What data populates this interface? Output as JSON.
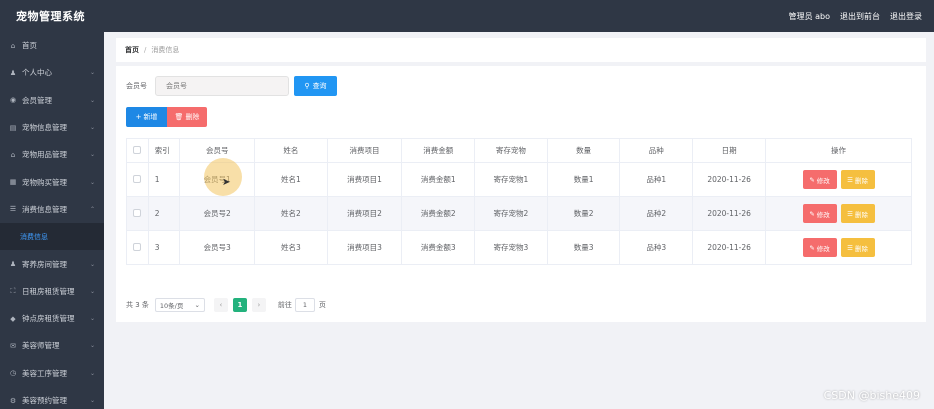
{
  "app": {
    "title": "宠物管理系统"
  },
  "topbar": {
    "user": "管理员 abo",
    "back_to_front": "退出到前台",
    "logout": "退出登录"
  },
  "sidebar": {
    "items": [
      {
        "label": "首页",
        "icon": "home-icon",
        "chevron": false
      },
      {
        "label": "个人中心",
        "icon": "user-icon",
        "chevron": true
      },
      {
        "label": "会员管理",
        "icon": "microphone-icon",
        "chevron": true
      },
      {
        "label": "宠物信息管理",
        "icon": "doc-icon",
        "chevron": true
      },
      {
        "label": "宠物用品管理",
        "icon": "bank-icon",
        "chevron": true
      },
      {
        "label": "宠物购买管理",
        "icon": "grid-icon",
        "chevron": true
      },
      {
        "label": "消费信息管理",
        "icon": "list-icon",
        "chevron": true,
        "expanded": true
      },
      {
        "label": "消费信息",
        "submenu": true
      },
      {
        "label": "寄养房间管理",
        "icon": "user-icon",
        "chevron": true
      },
      {
        "label": "日租房租赁管理",
        "icon": "fullscreen-icon",
        "chevron": true
      },
      {
        "label": "钟点房租赁管理",
        "icon": "location-icon",
        "chevron": true
      },
      {
        "label": "美容师管理",
        "icon": "mail-icon",
        "chevron": true
      },
      {
        "label": "美容工序管理",
        "icon": "clock-icon",
        "chevron": true
      },
      {
        "label": "美容预约管理",
        "icon": "settings-icon",
        "chevron": true
      }
    ]
  },
  "breadcrumb": {
    "home": "首页",
    "sep": "/",
    "current": "消费信息"
  },
  "search": {
    "label": "会员号",
    "placeholder": "会员号",
    "button": "查询"
  },
  "toolbar": {
    "add": "新增",
    "delete": "删除"
  },
  "table": {
    "headers": [
      "索引",
      "会员号",
      "姓名",
      "消费项目",
      "消费金额",
      "寄存宠物",
      "数量",
      "品种",
      "日期",
      "操作"
    ],
    "rows": [
      [
        "1",
        "会员号1",
        "姓名1",
        "消费项目1",
        "消费金额1",
        "寄存宠物1",
        "数量1",
        "品种1",
        "2020-11-26"
      ],
      [
        "2",
        "会员号2",
        "姓名2",
        "消费项目2",
        "消费金额2",
        "寄存宠物2",
        "数量2",
        "品种2",
        "2020-11-26"
      ],
      [
        "3",
        "会员号3",
        "姓名3",
        "消费项目3",
        "消费金额3",
        "寄存宠物3",
        "数量3",
        "品种3",
        "2020-11-26"
      ]
    ],
    "edit_label": "修改",
    "delete_label": "删除"
  },
  "pagination": {
    "total": "共 3 条",
    "page_size": "10条/页",
    "current_page": "1",
    "goto_label": "前往",
    "goto_value": "1",
    "page_unit": "页"
  },
  "watermark": "CSDN @bishe409",
  "colors": {
    "sidebar_bg": "#2f3745",
    "primary": "#2196f3",
    "danger": "#f56c6c",
    "warning": "#f5bf3f",
    "success": "#23b27d"
  }
}
